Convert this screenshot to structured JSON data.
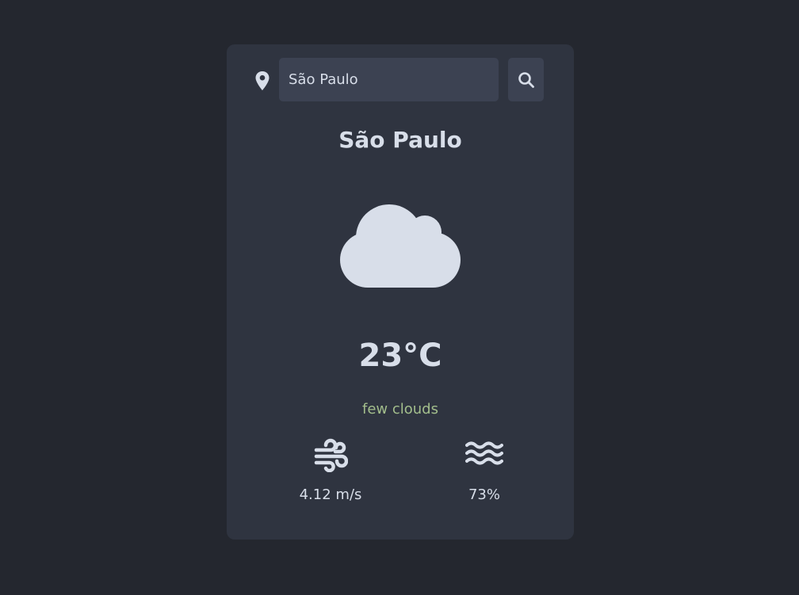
{
  "search": {
    "value": "São Paulo",
    "location_icon": "map-marker-icon",
    "button_icon": "search-icon"
  },
  "weather": {
    "city": "São Paulo",
    "icon": "cloud-icon",
    "temperature": "23°C",
    "description": "few clouds",
    "wind_speed": "4.12 m/s",
    "wind_icon": "wind-icon",
    "humidity": "73%",
    "humidity_icon": "water-icon"
  },
  "colors": {
    "page_background": "#24272f",
    "card_background": "#2f3440",
    "input_background": "#3c4252",
    "text": "#d8dee9",
    "description": "#a3be8c"
  }
}
